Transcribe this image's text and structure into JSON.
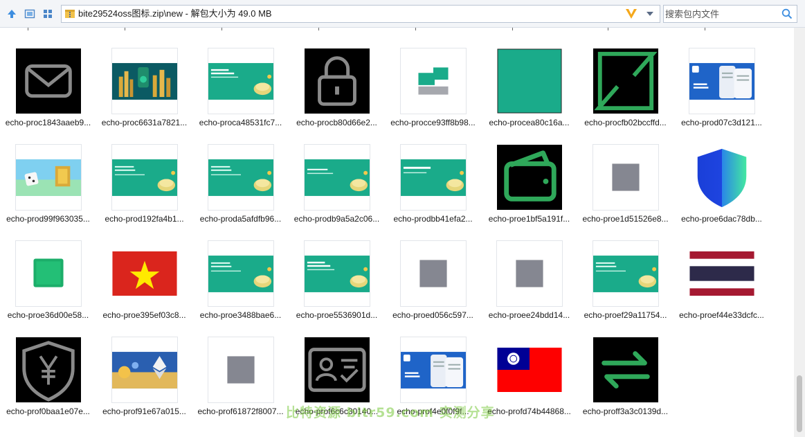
{
  "toolbar": {
    "path": "bite29524oss图标.zip\\new - 解包大小为 49.0 MB",
    "search_placeholder": "搜索包内文件"
  },
  "files": [
    {
      "name": "echo-proc1843aaeb9...",
      "thumb": "mail"
    },
    {
      "name": "echo-proc6631a7821...",
      "thumb": "city-banner"
    },
    {
      "name": "echo-proca48531fc7...",
      "thumb": "teal-banner-cn"
    },
    {
      "name": "echo-procb80d66e2...",
      "thumb": "lock"
    },
    {
      "name": "echo-procce93ff8b98...",
      "thumb": "green-gray-blocks"
    },
    {
      "name": "echo-procea80c16a...",
      "thumb": "teal-square"
    },
    {
      "name": "echo-procfb02bccffd...",
      "thumb": "green-brackets"
    },
    {
      "name": "echo-prod07c3d121...",
      "thumb": "stake-trust"
    },
    {
      "name": "echo-prod99f963035...",
      "thumb": "dice-banner"
    },
    {
      "name": "echo-prod192fa4b1...",
      "thumb": "teal-banner-en"
    },
    {
      "name": "echo-proda5afdfb96...",
      "thumb": "teal-banner-en"
    },
    {
      "name": "echo-prodb9a5a2c06...",
      "thumb": "teal-banner-cn2"
    },
    {
      "name": "echo-prodbb41efa2...",
      "thumb": "teal-banner-cn3"
    },
    {
      "name": "echo-proe1bf5a191f...",
      "thumb": "wallet"
    },
    {
      "name": "echo-proe1d51526e8...",
      "thumb": "gray-square"
    },
    {
      "name": "echo-proe6dac78db...",
      "thumb": "shield"
    },
    {
      "name": "echo-proe36d00e58...",
      "thumb": "green-blob"
    },
    {
      "name": "echo-proe395ef03c8...",
      "thumb": "vietnam-flag"
    },
    {
      "name": "echo-proe3488bae6...",
      "thumb": "teal-banner-en"
    },
    {
      "name": "echo-proe5536901d...",
      "thumb": "teal-banner-cn"
    },
    {
      "name": "echo-proed056c597...",
      "thumb": "gray-square"
    },
    {
      "name": "echo-proee24bdd14...",
      "thumb": "gray-square"
    },
    {
      "name": "echo-proef29a11754...",
      "thumb": "teal-banner-en"
    },
    {
      "name": "echo-proef44e33dcfc...",
      "thumb": "thailand-flag"
    },
    {
      "name": "echo-prof0baa1e07e...",
      "thumb": "yen-shield"
    },
    {
      "name": "echo-prof91e67a015...",
      "thumb": "crypto-banner"
    },
    {
      "name": "echo-prof61872f8007...",
      "thumb": "gray-square"
    },
    {
      "name": "echo-prof6c6c30140...",
      "thumb": "id-card"
    },
    {
      "name": "echo-prof4e0f0f9f...",
      "thumb": "stake-trust"
    },
    {
      "name": "echo-profd74b44868...",
      "thumb": "taiwan-flag"
    },
    {
      "name": "echo-proff3a3c0139d...",
      "thumb": "swap-arrows"
    }
  ],
  "watermark": "比特资源 bitr59.com 实测分享",
  "colors": {
    "teal": "#1aab8a",
    "green": "#2fa85a",
    "gray": "#858791"
  }
}
